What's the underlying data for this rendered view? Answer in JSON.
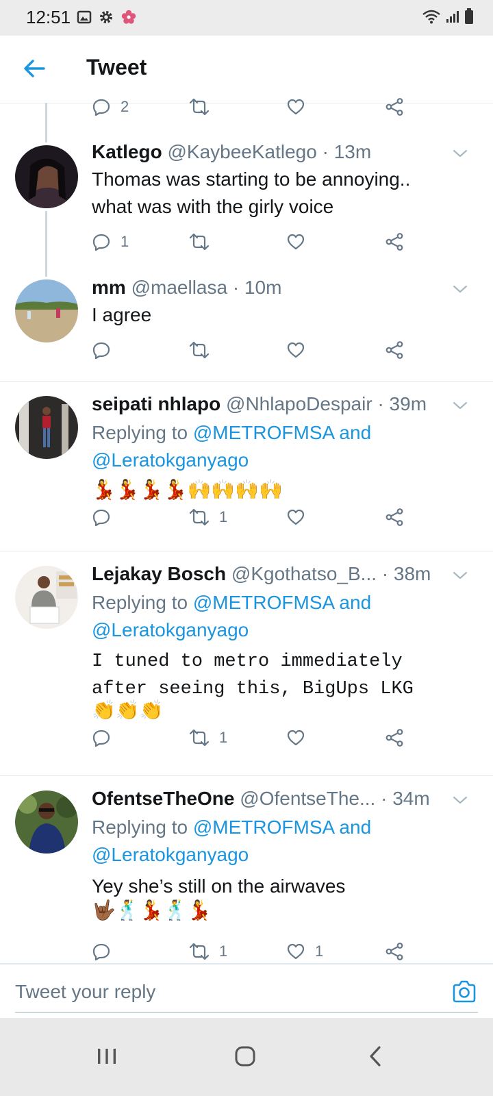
{
  "status_bar": {
    "time": "12:51"
  },
  "header": {
    "title": "Tweet"
  },
  "first_tweet_partial": {
    "reply_count": "2"
  },
  "tweets": [
    {
      "name": "Katlego",
      "handle": "@KaybeeKatlego",
      "time": "· 13m",
      "text_lines": [
        "Thomas was starting to be annoying..",
        "what was with the girly voice"
      ],
      "reply_count": "1",
      "retweet_count": "",
      "like_count": ""
    },
    {
      "name": "mm",
      "handle": "@maellasa",
      "time": "· 10m",
      "text_lines": [
        "I agree"
      ],
      "reply_count": "",
      "retweet_count": "",
      "like_count": ""
    },
    {
      "name": "seipati nhlapo",
      "handle": "@NhlapoDespair",
      "time": "· 39m",
      "replying_prefix": "Replying to",
      "mention_1": "@METROFMSA",
      "and_word": "and",
      "mention_2": "@Leratokganyago",
      "emoji_text": "💃💃💃💃🙌🙌🙌🙌",
      "reply_count": "",
      "retweet_count": "1",
      "like_count": ""
    },
    {
      "name": "Lejakay Bosch",
      "handle": "@Kgothatso_B...",
      "time": "· 38m",
      "replying_prefix": "Replying to",
      "mention_1": "@METROFMSA",
      "and_word": "and",
      "mention_2": "@Leratokganyago",
      "text_lines": [
        "I tuned to metro immediately",
        "after seeing this, BigUps LKG"
      ],
      "emoji_text": "👏👏👏",
      "reply_count": "",
      "retweet_count": "1",
      "like_count": ""
    },
    {
      "name": "OfentseTheOne",
      "handle": "@OfentseThe...",
      "time": "· 34m",
      "replying_prefix": "Replying to",
      "mention_1": "@METROFMSA",
      "and_word": "and",
      "mention_2": "@Leratokganyago",
      "text_lines": [
        "Yey she’s still on the airwaves"
      ],
      "emoji_text": "🤟🏾🕺💃🕺💃",
      "reply_count": "",
      "retweet_count": "1",
      "like_count": "1"
    }
  ],
  "composer": {
    "placeholder": "Tweet your reply"
  },
  "colors": {
    "accent": "#1b95e0",
    "text": "#14171a",
    "muted": "#657786",
    "divider": "#e1e8ed"
  }
}
